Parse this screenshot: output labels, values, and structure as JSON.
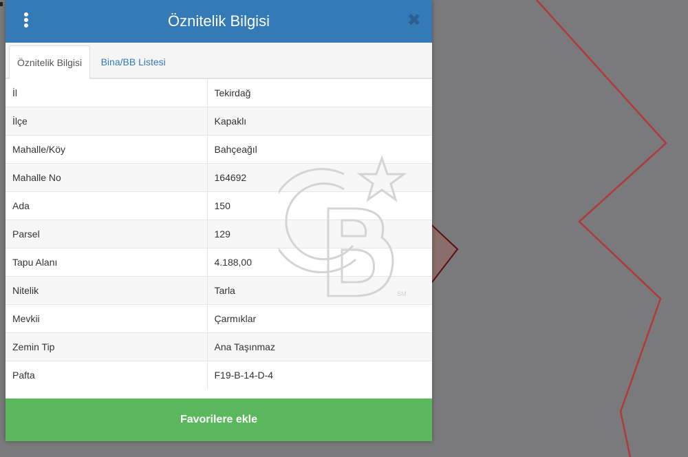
{
  "header": {
    "title": "Öznitelik Bilgisi",
    "menu_icon": "vertical-dots-icon",
    "close_icon": "close-icon"
  },
  "tabs": [
    {
      "label": "Öznitelik Bilgisi",
      "active": true
    },
    {
      "label": "Bina/BB Listesi",
      "active": false
    }
  ],
  "attributes": [
    {
      "key": "İl",
      "value": "Tekirdağ"
    },
    {
      "key": "İlçe",
      "value": "Kapaklı"
    },
    {
      "key": "Mahalle/Köy",
      "value": "Bahçeağıl"
    },
    {
      "key": "Mahalle No",
      "value": "164692"
    },
    {
      "key": "Ada",
      "value": "150"
    },
    {
      "key": "Parsel",
      "value": "129"
    },
    {
      "key": "Tapu Alanı",
      "value": "4.188,00"
    },
    {
      "key": "Nitelik",
      "value": "Tarla"
    },
    {
      "key": "Mevkii",
      "value": "Çarmıklar"
    },
    {
      "key": "Zemin Tip",
      "value": "Ana Taşınmaz"
    },
    {
      "key": "Pafta",
      "value": "F19-B-14-D-4"
    }
  ],
  "footer": {
    "favorite_label": "Favorilere ekle"
  },
  "watermark": {
    "mark": "SM"
  },
  "colors": {
    "header": "#337ab7",
    "favorite": "#5cb85c",
    "map_background": "#7a797b",
    "parcel_line": "#b03a3a"
  }
}
